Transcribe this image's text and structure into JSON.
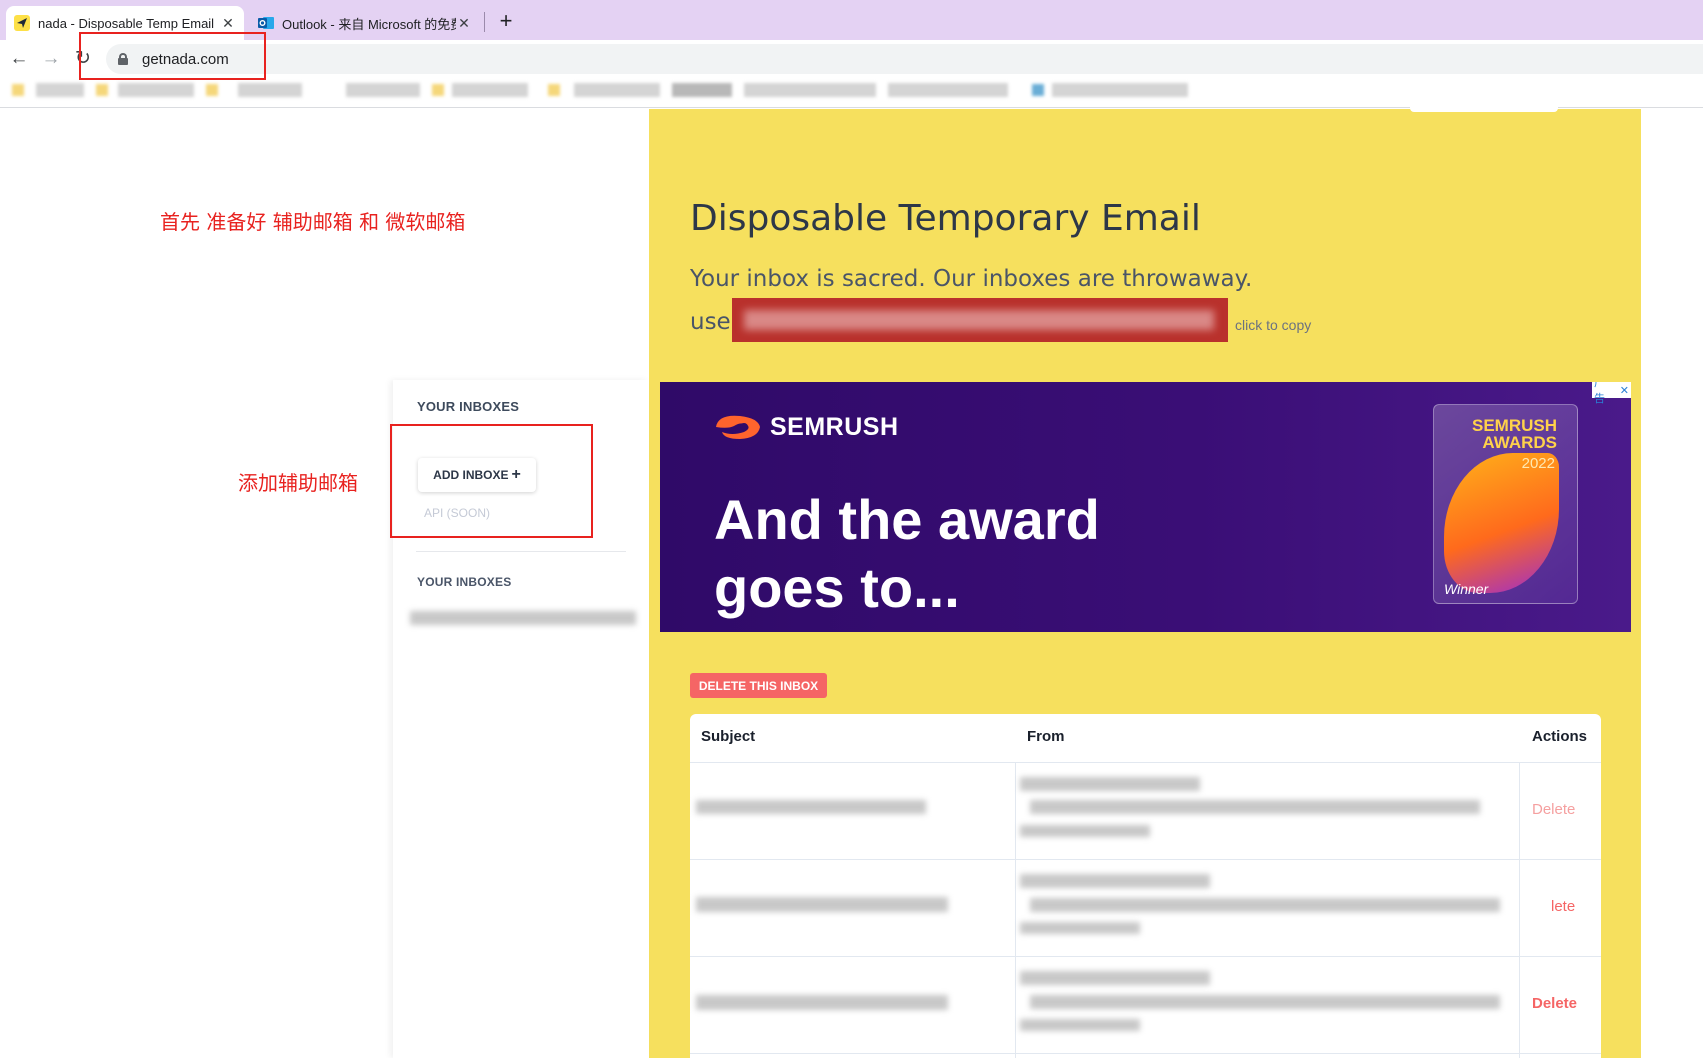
{
  "browser": {
    "tabs": [
      {
        "title": "nada - Disposable Temp Email",
        "icon": "paper-plane-icon",
        "active": true
      },
      {
        "title": "Outlook - 来自 Microsoft 的免费",
        "icon": "outlook-icon",
        "active": false
      }
    ],
    "close_glyph": "✕",
    "new_tab_glyph": "+",
    "nav": {
      "back": "←",
      "forward": "→",
      "reload": "↻"
    },
    "url": "getnada.com"
  },
  "annotations": {
    "prepare": "首先 准备好 辅助邮箱  和 微软邮箱",
    "add_aux": "添加辅助邮箱"
  },
  "sidebar": {
    "heading_top": "YOUR INBOXES",
    "add_button": "ADD INBOXE",
    "add_button_icon": "+",
    "api_link": "API (SOON)",
    "heading_list": "YOUR INBOXES"
  },
  "hero": {
    "title": "Disposable Temporary Email",
    "tagline": "Your inbox is sacred. Our inboxes are throwaway.",
    "use_label": "use",
    "copy_hint": "click to copy"
  },
  "ad": {
    "brand": "SEMRUSH",
    "headline_line1": "And the award",
    "headline_line2": "goes to...",
    "badge_label": "广告",
    "badge_close": "✕",
    "trophy_title_1": "SEMRUSH",
    "trophy_title_2": "AWARDS",
    "trophy_year": "2022",
    "trophy_winner": "Winner",
    "colors": {
      "background": "#2f0a68",
      "accent": "#ff642d"
    }
  },
  "inbox": {
    "delete_inbox": "DELETE THIS INBOX",
    "columns": {
      "subject": "Subject",
      "from": "From",
      "actions": "Actions"
    },
    "rows": [
      {
        "action": "Delete"
      },
      {
        "action": "lete"
      },
      {
        "action": "Delete"
      }
    ]
  },
  "colors": {
    "page_yellow": "#f6e05e",
    "annotation_red": "#e8221f",
    "delete_red": "#f56565",
    "tab_strip": "#e4d2f3"
  }
}
